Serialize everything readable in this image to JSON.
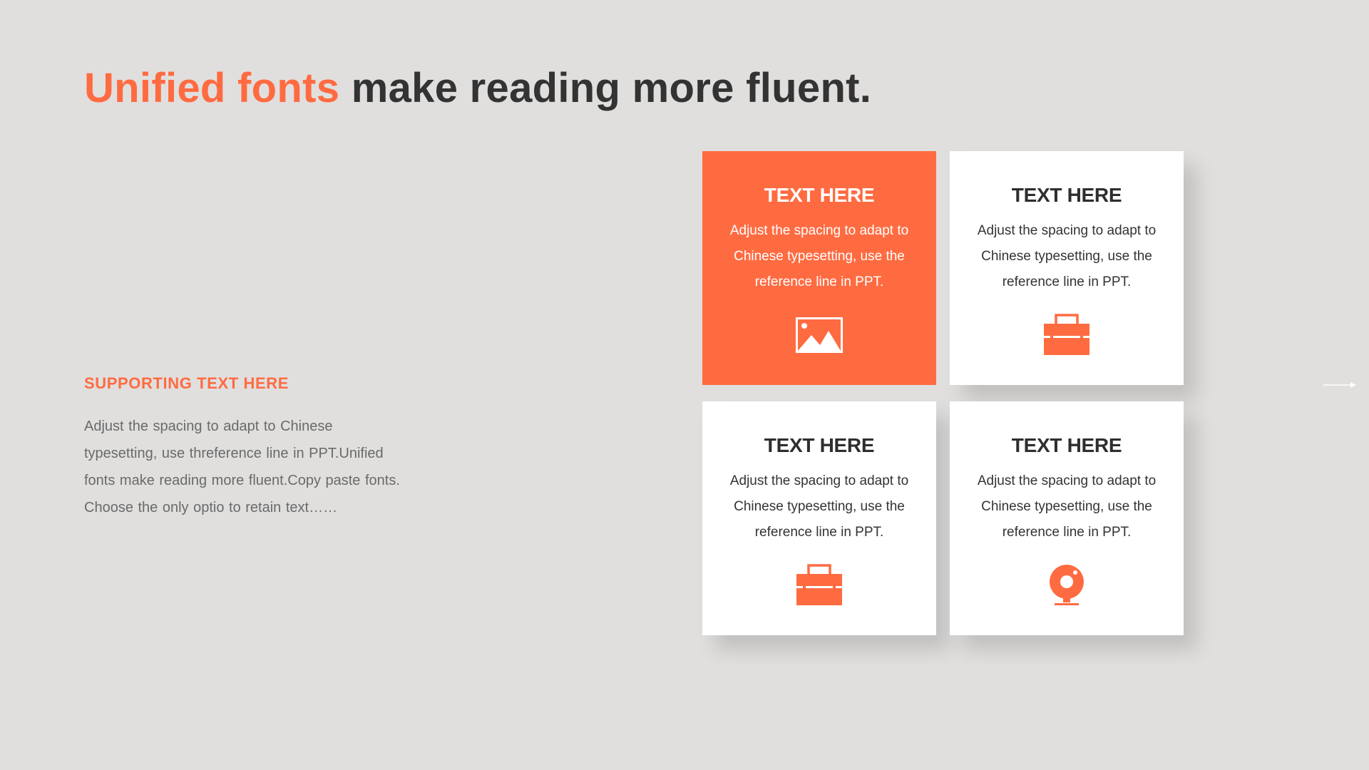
{
  "title": {
    "accent": "Unified fonts",
    "rest": " make reading more fluent."
  },
  "support": {
    "heading": "SUPPORTING  TEXT HERE",
    "body": "Adjust the spacing to adapt to Chinese typesetting, use threference line in PPT.Unified fonts make reading more fluent.Copy paste fonts. Choose the only optio to retain text……"
  },
  "cards": [
    {
      "title": "TEXT HERE",
      "text": "Adjust the spacing to adapt to Chinese  typesetting, use the reference line in PPT.",
      "icon": "image-icon"
    },
    {
      "title": "TEXT HERE",
      "text": "Adjust the spacing to adapt to Chinese  typesetting, use the reference line in PPT.",
      "icon": "briefcase-icon"
    },
    {
      "title": "TEXT HERE",
      "text": "Adjust the spacing to adapt to Chinese  typesetting, use the reference line in PPT.",
      "icon": "briefcase-icon"
    },
    {
      "title": "TEXT HERE",
      "text": "Adjust the spacing to adapt to Chinese  typesetting, use the reference line in PPT.",
      "icon": "webcam-icon"
    }
  ],
  "colors": {
    "accent": "#FF6B41",
    "background": "#E0DFDE",
    "dark_text": "#333333",
    "body_text": "#6A6A6A",
    "card": "#FFFFFF"
  }
}
